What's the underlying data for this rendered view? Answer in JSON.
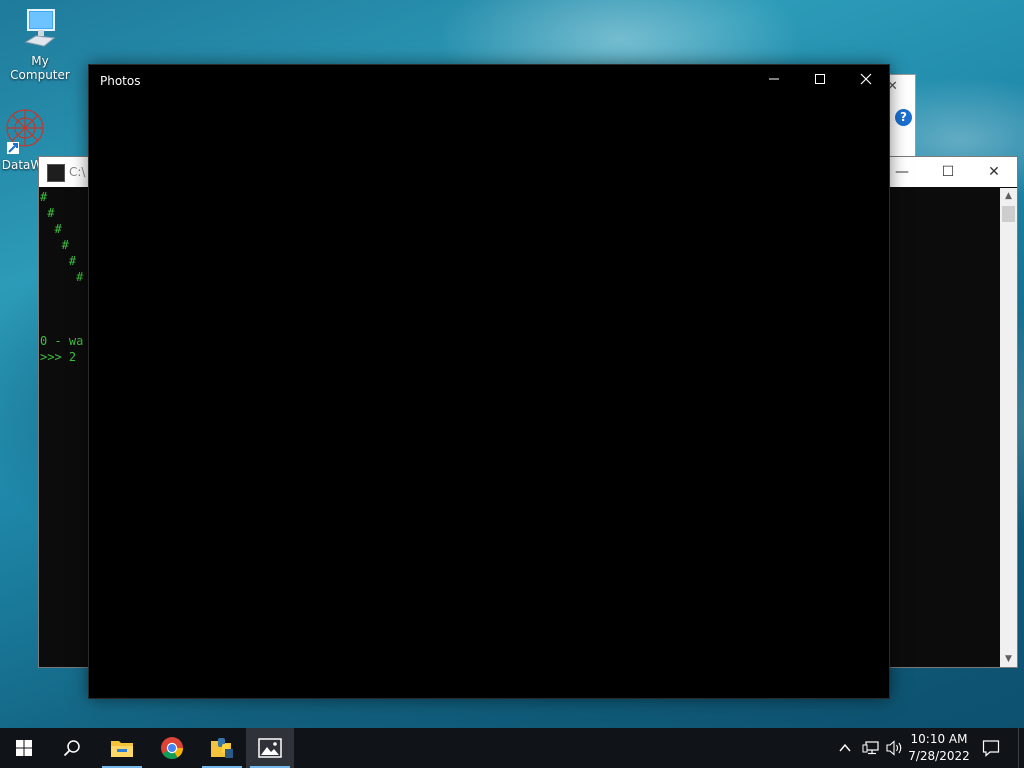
{
  "desktop": {
    "icons": [
      {
        "label": "My Computer",
        "icon": "computer-icon"
      },
      {
        "label": "DataW",
        "icon": "datawarrior-icon"
      }
    ]
  },
  "console": {
    "title": "C:\\",
    "lines": [
      "#",
      " #",
      "  #",
      "   #",
      "    #",
      "     #",
      "0 - wa",
      ">>> 2"
    ],
    "text_color": "#3ec13e"
  },
  "photos": {
    "title": "Photos",
    "minimize_label": "—",
    "maximize_label": "☐",
    "close_label": "✕"
  },
  "dialog": {
    "help_label": "?",
    "close_label": "✕"
  },
  "taskbar": {
    "apps": [
      {
        "name": "start",
        "icon": "windows-start-icon"
      },
      {
        "name": "search",
        "icon": "search-icon"
      },
      {
        "name": "file-explorer",
        "icon": "folder-icon"
      },
      {
        "name": "chrome",
        "icon": "chrome-icon"
      },
      {
        "name": "python",
        "icon": "python-icon"
      },
      {
        "name": "photos",
        "icon": "photos-icon"
      }
    ],
    "time": "10:10 AM",
    "date": "7/28/2022"
  }
}
